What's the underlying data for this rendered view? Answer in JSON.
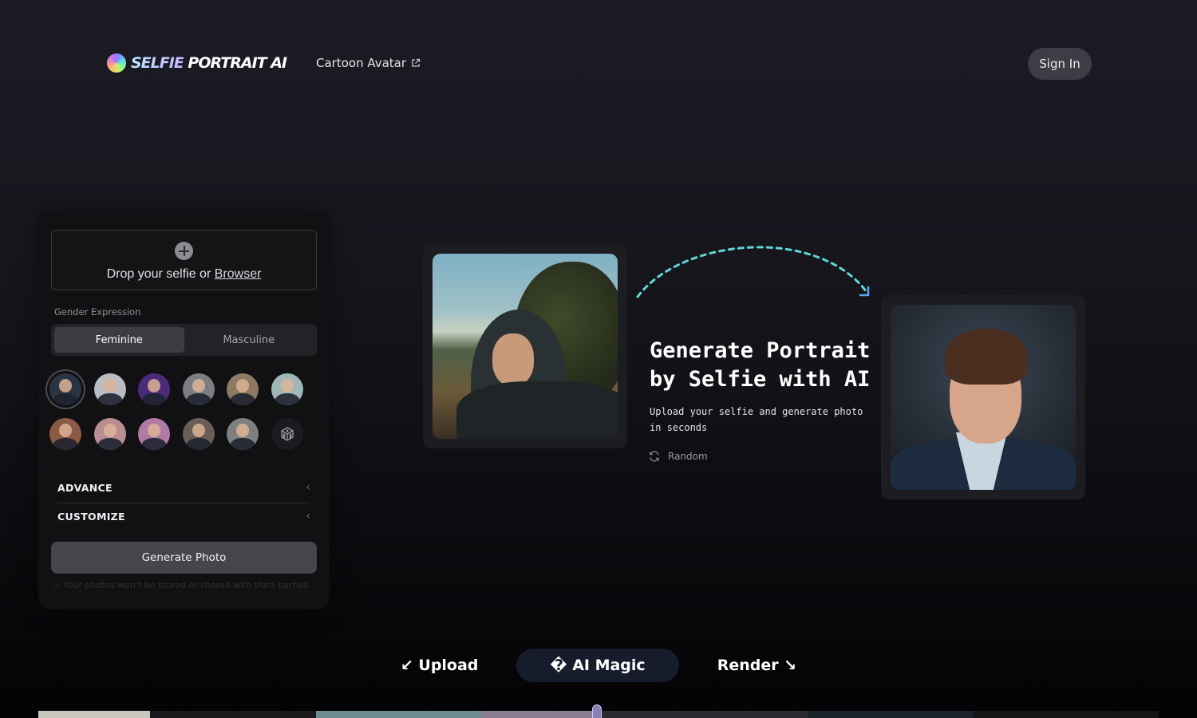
{
  "header": {
    "logo_part1": "SELFIE",
    "logo_part2": " PORTRAIT AI",
    "nav_link": "Cartoon Avatar",
    "nav_link_icon": "external-link-icon",
    "sign_in": "Sign In"
  },
  "panel": {
    "upload": {
      "icon": "plus-circle-icon",
      "text": "Drop your selfie or ",
      "link": "Browser"
    },
    "gender": {
      "label": "Gender Expression",
      "options": [
        "Feminine",
        "Masculine"
      ],
      "selected": "Feminine"
    },
    "styles": {
      "items": [
        {
          "name": "business-man-dark",
          "selected": true,
          "bg": "#2b3442"
        },
        {
          "name": "asian-man-suit",
          "selected": false,
          "bg": "#b9bcc0"
        },
        {
          "name": "man-purple-backdrop",
          "selected": false,
          "bg": "#4b2a7a"
        },
        {
          "name": "woman-suit-office",
          "selected": false,
          "bg": "#7c7f82"
        },
        {
          "name": "woman-lab-coat",
          "selected": false,
          "bg": "#8e7a62"
        },
        {
          "name": "asian-woman-portrait",
          "selected": false,
          "bg": "#9fb8b6"
        },
        {
          "name": "athlete-stadium",
          "selected": false,
          "bg": "#8a5a44"
        },
        {
          "name": "woman-dreamy",
          "selected": false,
          "bg": "#b88e94"
        },
        {
          "name": "festival-colors",
          "selected": false,
          "bg": "#b07aa4"
        },
        {
          "name": "astronaut",
          "selected": false,
          "bg": "#6a5d58"
        },
        {
          "name": "street-group",
          "selected": false,
          "bg": "#7e8080"
        }
      ],
      "random_icon": "dice-icon"
    },
    "sections": [
      "ADVANCE",
      "CUSTOMIZE"
    ],
    "generate_button": "Generate Photo",
    "privacy_note": "Your photos won't be stored or shared with third parties"
  },
  "hero": {
    "title": "Generate Portrait\nby Selfie with AI",
    "subtitle": "Upload your selfie and generate photo in seconds",
    "random_label": "Random",
    "before_image": "selfie-hoodie-man",
    "after_image": "ai-portrait-man-suit"
  },
  "steps": [
    {
      "label": "↙ Upload",
      "active": false
    },
    {
      "label": "� AI Magic",
      "active": true
    },
    {
      "label": "Render ↘",
      "active": false
    }
  ],
  "gallery": {
    "colors": [
      "#c8c6be",
      "#1a1a1c",
      "#6d8a8e",
      "#8b7b90",
      "#2b2a2e",
      "#1a2128",
      "#141417"
    ]
  },
  "colors": {
    "accent_arc": "#5fd6d6",
    "arrow_head": "#5aa7e8",
    "active_step_bg": "#161c2c"
  }
}
